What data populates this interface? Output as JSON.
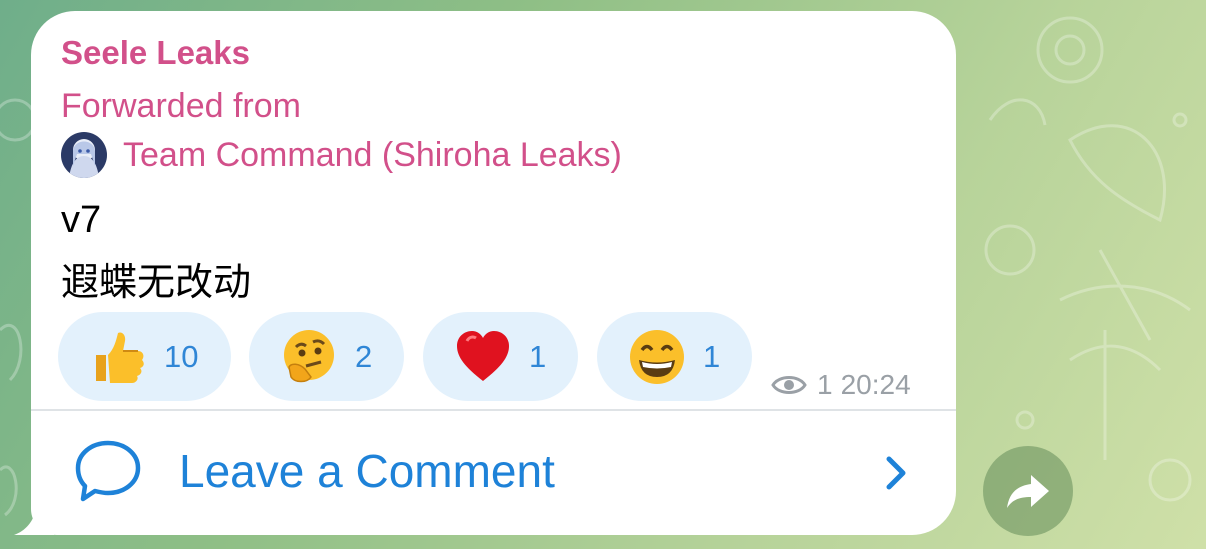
{
  "message": {
    "sender": "Seele Leaks",
    "forwarded_label": "Forwarded from",
    "forwarded_source": "Team Command (Shiroha Leaks)",
    "text_line1": "v7",
    "text_line2": "遐蝶无改动"
  },
  "reactions": [
    {
      "icon": "thumbs-up-emoji",
      "count": "10"
    },
    {
      "icon": "thinking-face-emoji",
      "count": "2"
    },
    {
      "icon": "red-heart-emoji",
      "count": "1"
    },
    {
      "icon": "grinning-face-emoji",
      "count": "1"
    }
  ],
  "meta": {
    "views": "1",
    "time": "20:24"
  },
  "comments": {
    "label": "Leave a Comment"
  },
  "colors": {
    "name_accent": "#d2508a",
    "link_blue": "#1e82d8",
    "reaction_bg": "#e3f1fc",
    "bubble_bg": "#ffffff"
  }
}
